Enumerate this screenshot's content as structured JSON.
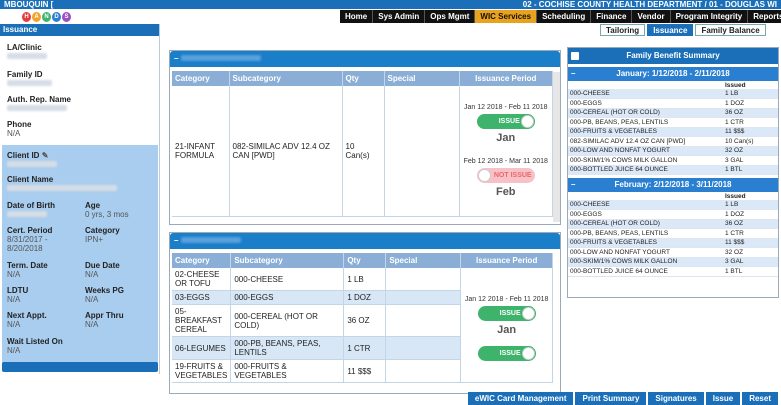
{
  "header": {
    "user": "MBOUQUIN [",
    "dept": "02 - COCHISE COUNTY HEALTH DEPARTMENT / 01 - DOUGLAS WI",
    "logo_letters": [
      "H",
      "A",
      "N",
      "D",
      "S"
    ]
  },
  "nav": [
    "Home",
    "Sys Admin",
    "Ops Mgmt",
    "WIC Services",
    "Scheduling",
    "Finance",
    "Vendor",
    "Program Integrity",
    "Reports",
    "Help"
  ],
  "nav_active": "WIC Services",
  "subtabs": [
    "Tailoring",
    "Issuance",
    "Family Balance"
  ],
  "subtab_active": "Issuance",
  "left": {
    "header": "Issuance",
    "la_clinic_label": "LA/Clinic",
    "family_id_label": "Family ID",
    "auth_rep_label": "Auth. Rep. Name",
    "phone_label": "Phone",
    "phone_value": "N/A",
    "client_id_label": "Client ID",
    "client_name_label": "Client Name",
    "dob_label": "Date of Birth",
    "age_label": "Age",
    "age_value": "0 yrs, 3 mos",
    "cert_label": "Cert. Period",
    "cert_value_1": "8/31/2017 -",
    "cert_value_2": "8/20/2018",
    "category_label": "Category",
    "category_value": "IPN+",
    "term_label": "Term. Date",
    "term_value": "N/A",
    "due_label": "Due Date",
    "due_value": "N/A",
    "ldtu_label": "LDTU",
    "ldtu_value": "N/A",
    "weeks_label": "Weeks PG",
    "weeks_value": "N/A",
    "next_appt_label": "Next Appt.",
    "next_appt_value": "N/A",
    "appr_label": "Appr Thru",
    "appr_value": "N/A",
    "wait_label": "Wait Listed On",
    "wait_value": "N/A"
  },
  "panel1": {
    "columns": [
      "Category",
      "Subcategory",
      "Qty",
      "Special",
      "Issuance Period"
    ],
    "row": {
      "category": "21-INFANT FORMULA",
      "subcategory": "082-SIMILAC ADV 12.4 OZ CAN [PWD]",
      "qty": "10 Can(s)"
    },
    "period1": {
      "dates": "Jan 12 2018 - Feb 11 2018",
      "toggle": "ISSUE",
      "month": "Jan"
    },
    "period2": {
      "dates": "Feb 12 2018 - Mar 11 2018",
      "toggle": "NOT ISSUE",
      "month": "Feb"
    }
  },
  "panel2": {
    "columns": [
      "Category",
      "Subcategory",
      "Qty",
      "Special",
      "Issuance Period"
    ],
    "rows": [
      {
        "category": "02-CHEESE OR TOFU",
        "subcategory": "000-CHEESE",
        "qty": "1 LB"
      },
      {
        "category": "03-EGGS",
        "subcategory": "000-EGGS",
        "qty": "1 DOZ"
      },
      {
        "category": "05-BREAKFAST CEREAL",
        "subcategory": "000-CEREAL (HOT OR COLD)",
        "qty": "36 OZ"
      },
      {
        "category": "06-LEGUMES",
        "subcategory": "000-PB, BEANS, PEAS, LENTILS",
        "qty": "1 CTR"
      },
      {
        "category": "19-FRUITS & VEGETABLES",
        "subcategory": "000-FRUITS & VEGETABLES",
        "qty": "11 $$$"
      }
    ],
    "period1": {
      "dates": "Jan 12 2018 - Feb 11 2018",
      "toggle": "ISSUE",
      "month": "Jan"
    },
    "period2": {
      "toggle": "ISSUE"
    }
  },
  "summary": {
    "title": "Family Benefit Summary",
    "months": [
      {
        "label": "January: 1/12/2018 - 2/11/2018",
        "issued_header": "Issued",
        "items": [
          [
            "000-CHEESE",
            "1 LB"
          ],
          [
            "000-EGGS",
            "1 DOZ"
          ],
          [
            "000-CEREAL (HOT OR COLD)",
            "36 OZ"
          ],
          [
            "000-PB, BEANS, PEAS, LENTILS",
            "1 CTR"
          ],
          [
            "000-FRUITS & VEGETABLES",
            "11 $$$"
          ],
          [
            "082-SIMILAC ADV 12.4 OZ CAN [PWD]",
            "10 Can(s)"
          ],
          [
            "000-LOW AND NONFAT YOGURT",
            "32 OZ"
          ],
          [
            "000-SKIM/1% COWS MILK GALLON",
            "3 GAL"
          ],
          [
            "000-BOTTLED JUICE 64 OUNCE",
            "1 BTL"
          ]
        ]
      },
      {
        "label": "February: 2/12/2018 - 3/11/2018",
        "issued_header": "Issued",
        "items": [
          [
            "000-CHEESE",
            "1 LB"
          ],
          [
            "000-EGGS",
            "1 DOZ"
          ],
          [
            "000-CEREAL (HOT OR COLD)",
            "36 OZ"
          ],
          [
            "000-PB, BEANS, PEAS, LENTILS",
            "1 CTR"
          ],
          [
            "000-FRUITS & VEGETABLES",
            "11 $$$"
          ],
          [
            "000-LOW AND NONFAT YOGURT",
            "32 OZ"
          ],
          [
            "000-SKIM/1% COWS MILK GALLON",
            "3 GAL"
          ],
          [
            "000-BOTTLED JUICE 64 OUNCE",
            "1 BTL"
          ]
        ]
      }
    ]
  },
  "bottom_buttons": [
    "eWIC Card Management",
    "Print Summary",
    "Signatures",
    "Issue",
    "Reset"
  ],
  "colors": {
    "primary": "#1a6fb8",
    "accent": "#e8a21c",
    "issue_on": "#3db36b",
    "issue_off": "#f6c2c8"
  }
}
